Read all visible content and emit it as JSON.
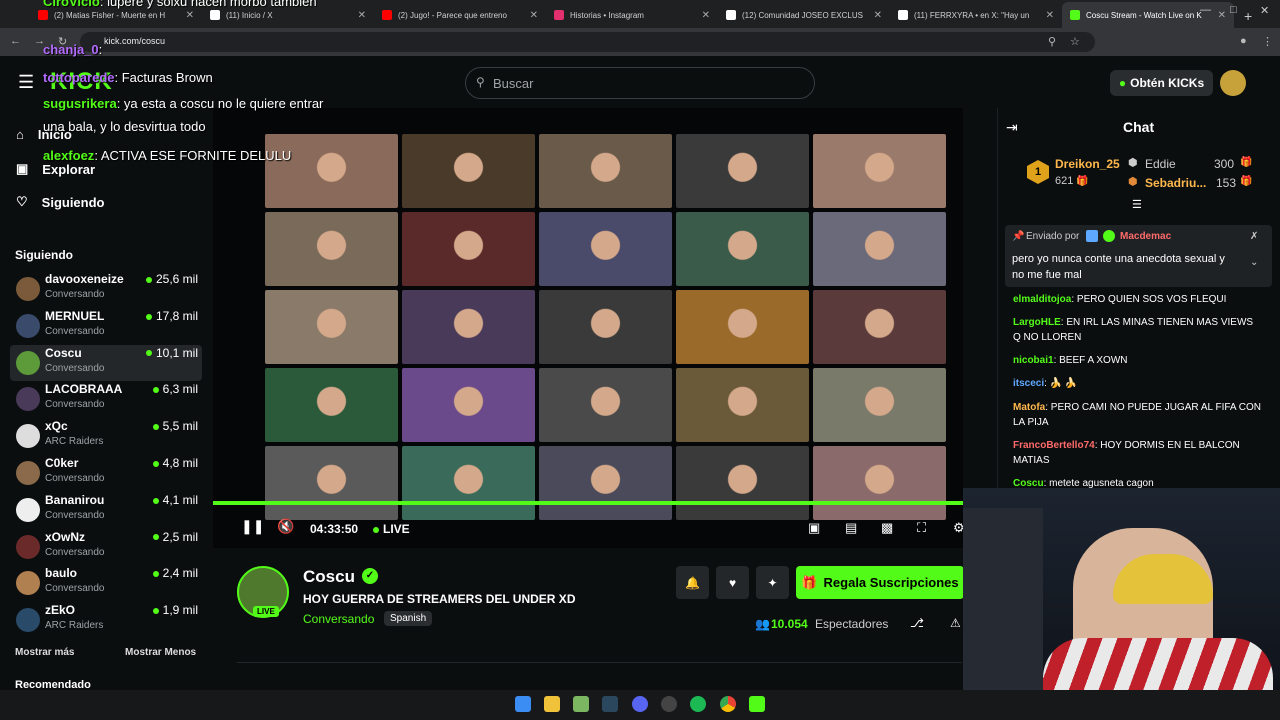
{
  "browser": {
    "tabs": [
      {
        "title": "(2) Matias Fisher - Muerte en H",
        "color": "#ff0000"
      },
      {
        "title": "(11) Inicio / X",
        "color": "#ffffff"
      },
      {
        "title": "(2) Jugo! - Parece que entreno",
        "color": "#ff0000"
      },
      {
        "title": "Historias • Instagram",
        "color": "#e1306c"
      },
      {
        "title": "(12) Comunidad JOSEO EXCLUS",
        "color": "#ffffff"
      },
      {
        "title": "(11) FERRXYRA • en X: \"Hay un",
        "color": "#ffffff"
      },
      {
        "title": "Coscu Stream - Watch Live on K",
        "color": "#53fc18"
      }
    ],
    "url": "kick.com/coscu"
  },
  "header": {
    "search_placeholder": "Buscar",
    "get_kicks": "Obtén KICKs",
    "logo": "KICK"
  },
  "sidebar": {
    "nav": [
      {
        "label": "Inicio",
        "icon": "home-icon"
      },
      {
        "label": "Explorar",
        "icon": "compass-icon"
      },
      {
        "label": "Siguiendo",
        "icon": "heart-icon"
      }
    ],
    "following_title": "Siguiendo",
    "following": [
      {
        "name": "davooxeneize",
        "cat": "Conversando",
        "viewers": "25,6 mil",
        "color": "#7a5a3a"
      },
      {
        "name": "MERNUEL",
        "cat": "Conversando",
        "viewers": "17,8 mil",
        "color": "#3a4a6a"
      },
      {
        "name": "Coscu",
        "cat": "Conversando",
        "viewers": "10,1 mil",
        "color": "#5c9a3a"
      },
      {
        "name": "LACOBRAAA",
        "cat": "Conversando",
        "viewers": "6,3 mil",
        "color": "#4a3a5a"
      },
      {
        "name": "xQc",
        "cat": "ARC Raiders",
        "viewers": "5,5 mil",
        "color": "#dddddd"
      },
      {
        "name": "C0ker",
        "cat": "Conversando",
        "viewers": "4,8 mil",
        "color": "#8a6a4a"
      },
      {
        "name": "Bananirou",
        "cat": "Conversando",
        "viewers": "4,1 mil",
        "color": "#eeeeee"
      },
      {
        "name": "xOwNz",
        "cat": "Conversando",
        "viewers": "2,5 mil",
        "color": "#6a2a2a"
      },
      {
        "name": "baulo",
        "cat": "Conversando",
        "viewers": "2,4 mil",
        "color": "#b08050"
      },
      {
        "name": "zEkO",
        "cat": "ARC Raiders",
        "viewers": "1,9 mil",
        "color": "#2a4a6a"
      }
    ],
    "show_more": "Mostrar más",
    "show_less": "Mostrar Menos",
    "recommended": "Recomendado"
  },
  "overlay_chat": [
    {
      "user": "CiroVicio",
      "msg": ": lupere y solxu hacen morbo tambien",
      "color": "#53fc18"
    },
    {
      "user": "chanja_0",
      "msg": ":",
      "color": "#b36bff"
    },
    {
      "user": "tottoparede",
      "msg": ": Facturas Brown",
      "color": "#b36bff"
    },
    {
      "user": "sugusrikera",
      "msg": ": ya esta a coscu no le quiere entrar",
      "color": "#53fc18"
    },
    {
      "user": "",
      "msg": "una bala, y lo desvirtua todo",
      "color": "#ffffff"
    },
    {
      "user": "alexfoez",
      "msg": ": ACTIVA ESE FORNITE DELULU",
      "color": "#53fc18"
    }
  ],
  "player": {
    "time": "04:33:50",
    "live": "LIVE"
  },
  "stream": {
    "channel": "Coscu",
    "title": "HOY GUERRA DE STREAMERS DEL UNDER XD",
    "category": "Conversando",
    "language": "Spanish",
    "live_badge": "LIVE",
    "viewers": "10.054",
    "viewers_label": "Espectadores",
    "gift_label": "Regala Suscripciones"
  },
  "chat": {
    "title": "Chat",
    "top": [
      {
        "rank": "1",
        "name": "Dreikon_25",
        "amount": "621"
      },
      {
        "name": "Eddie",
        "amount": "300"
      },
      {
        "name": "Sebadriu...",
        "amount": "153"
      }
    ],
    "pinned_by_label": "Enviado por",
    "pinned_user": "Macdemac",
    "pinned_msg": "pero yo nunca conte una anecdota sexual y no me fue mal",
    "messages": [
      {
        "user": "elmalditojoa",
        "color": "#53fc18",
        "text": ": PERO QUIEN SOS VOS FLEQUI"
      },
      {
        "user": "LargoHLE",
        "color": "#53fc18",
        "text": ": EN IRL LAS MINAS TIENEN MAS VIEWS Q NO LLOREN"
      },
      {
        "user": "nicobai1",
        "color": "#53fc18",
        "text": ": BEEF A XOWN"
      },
      {
        "user": "itsceci",
        "color": "#5fa8ff",
        "text": ": 🍌 🍌"
      },
      {
        "user": "Matofa",
        "color": "#ffb84d",
        "text": ": PERO CAMI NO PUEDE JUGAR AL FIFA CON LA PIJA"
      },
      {
        "user": "FrancoBertello74",
        "color": "#ff6a6a",
        "text": ": HOY DORMIS EN EL BALCON MATIAS"
      },
      {
        "user": "Coscu",
        "color": "#53fc18",
        "text": ": metete agusneta cagon"
      }
    ]
  },
  "colors": {
    "accent": "#53fc18",
    "bg": "#0b0e0f"
  }
}
